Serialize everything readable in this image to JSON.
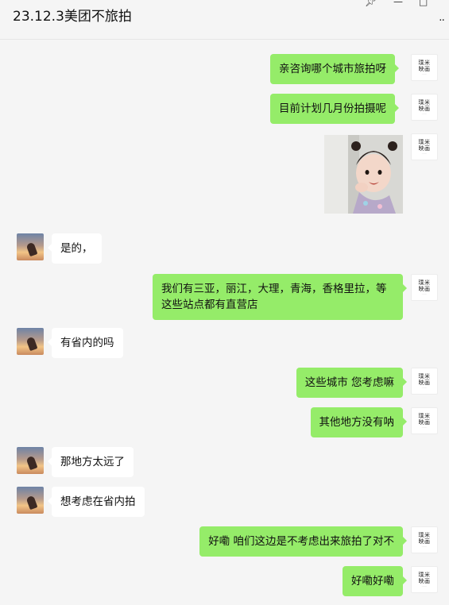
{
  "window": {
    "title": "23.12.3美团不旅拍",
    "pin_icon": "pin-icon",
    "minimize_icon": "minimize-icon",
    "maximize_icon": "maximize-icon",
    "more_icon": "more-dots-icon"
  },
  "me_avatar": {
    "logo_line1": "璞米",
    "logo_line2": "映画"
  },
  "messages": [
    {
      "sender": "me",
      "type": "text",
      "text": "亲咨询哪个城市旅拍呀"
    },
    {
      "sender": "me",
      "type": "text",
      "text": "目前计划几月份拍摄呢"
    },
    {
      "sender": "me",
      "type": "image",
      "description": "sticker"
    },
    {
      "sender": "them",
      "type": "text",
      "text": "是的，"
    },
    {
      "sender": "me",
      "type": "text",
      "text": "我们有三亚，丽江，大理，青海，香格里拉，等这些站点都有直营店",
      "line1": "我们有三亚，丽江，大理，青海，香格里拉，等",
      "line2": "这些站点都有直营店"
    },
    {
      "sender": "them",
      "type": "text",
      "text": "有省内的吗"
    },
    {
      "sender": "me",
      "type": "text",
      "text": "这些城市 您考虑嘛"
    },
    {
      "sender": "me",
      "type": "text",
      "text": "其他地方没有呐"
    },
    {
      "sender": "them",
      "type": "text",
      "text": "那地方太远了"
    },
    {
      "sender": "them",
      "type": "text",
      "text": "想考虑在省内拍"
    },
    {
      "sender": "me",
      "type": "text",
      "text": "好嘞 咱们这边是不考虑出来旅拍了对不"
    },
    {
      "sender": "me",
      "type": "text",
      "text": "好嘞好嘞"
    }
  ],
  "colors": {
    "my_bubble": "#95ec69",
    "their_bubble": "#ffffff",
    "background": "#f5f5f5"
  }
}
